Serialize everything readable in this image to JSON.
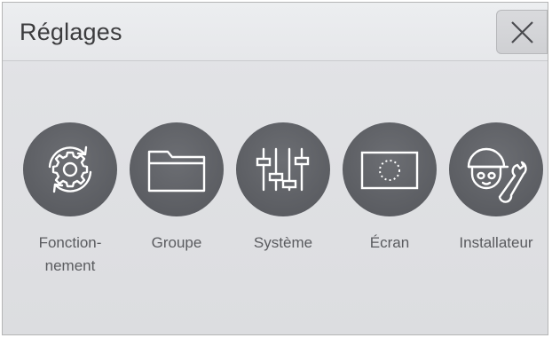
{
  "header": {
    "title": "Réglages"
  },
  "close": {
    "icon": "close-icon"
  },
  "menu": [
    {
      "id": "fonctionnement",
      "line1": "Fonction-",
      "line2": "nement",
      "icon": "gear-refresh-icon"
    },
    {
      "id": "groupe",
      "line1": "Groupe",
      "line2": "",
      "icon": "folder-icon"
    },
    {
      "id": "systeme",
      "line1": "Système",
      "line2": "",
      "icon": "sliders-icon"
    },
    {
      "id": "ecran",
      "line1": "Écran",
      "line2": "",
      "icon": "screen-icon"
    },
    {
      "id": "installateur",
      "line1": "Installateur",
      "line2": "",
      "icon": "installer-icon"
    }
  ],
  "colors": {
    "icon_circle": "#5e6065",
    "icon_stroke": "#ffffff",
    "text": "#5a5b5f"
  }
}
